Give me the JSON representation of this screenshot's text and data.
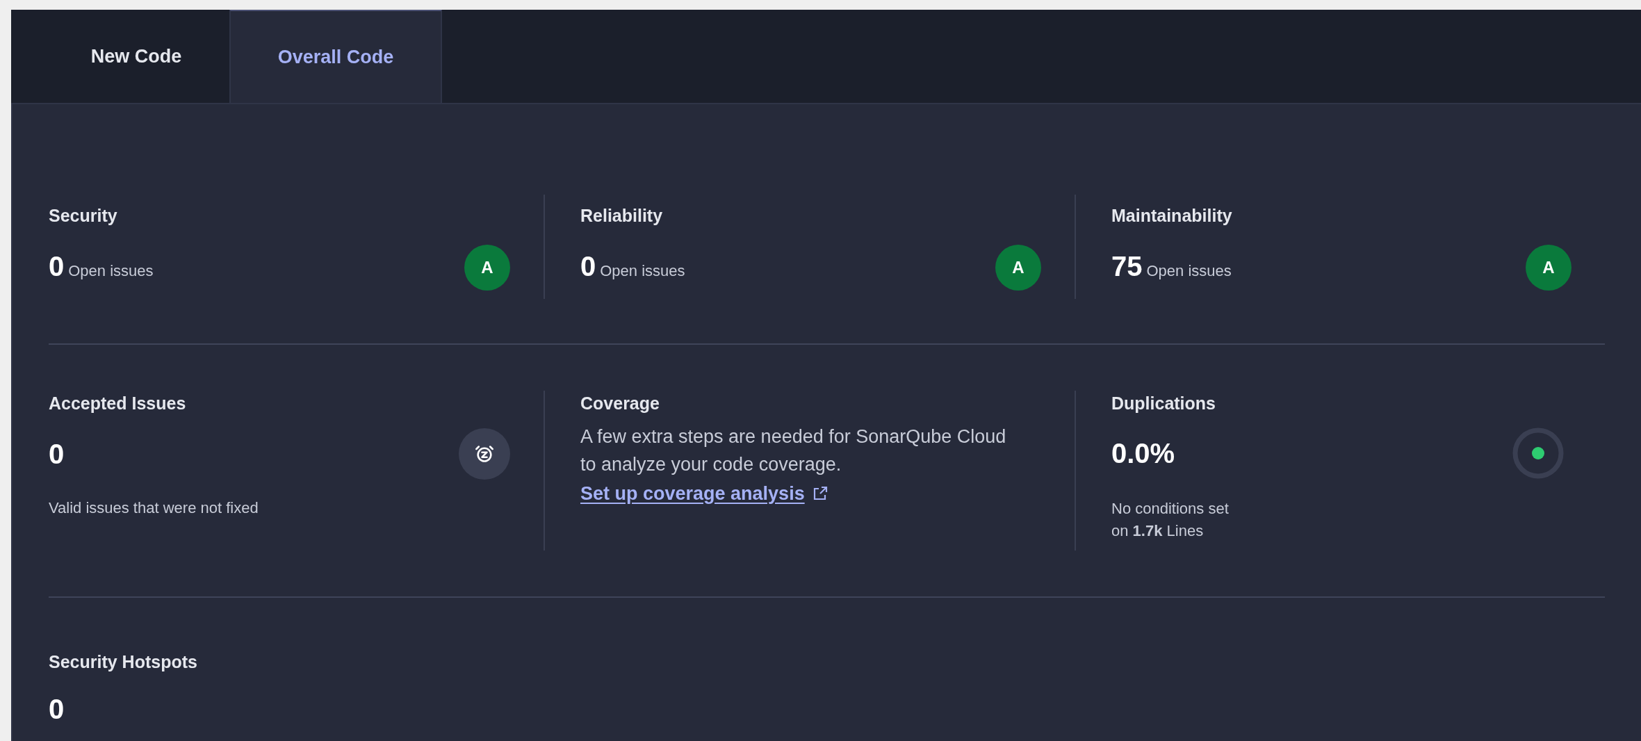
{
  "tabs": [
    {
      "label": "New Code",
      "selected": false
    },
    {
      "label": "Overall Code",
      "selected": true
    }
  ],
  "ratings": [
    {
      "title": "Security",
      "value": "0",
      "unit": "Open issues",
      "grade": "A"
    },
    {
      "title": "Reliability",
      "value": "0",
      "unit": "Open issues",
      "grade": "A"
    },
    {
      "title": "Maintainability",
      "value": "75",
      "unit": "Open issues",
      "grade": "A"
    }
  ],
  "accepted_issues": {
    "title": "Accepted Issues",
    "value": "0",
    "description": "Valid issues that were not fixed"
  },
  "coverage": {
    "title": "Coverage",
    "description": "A few extra steps are needed for SonarQube Cloud to analyze your code coverage.",
    "link": "Set up coverage analysis"
  },
  "duplications": {
    "title": "Duplications",
    "value": "0.0%",
    "description_lines": [
      "No conditions set",
      "on **1.7k** Lines"
    ]
  },
  "security_hotspots": {
    "title": "Security Hotspots",
    "value": "0"
  }
}
